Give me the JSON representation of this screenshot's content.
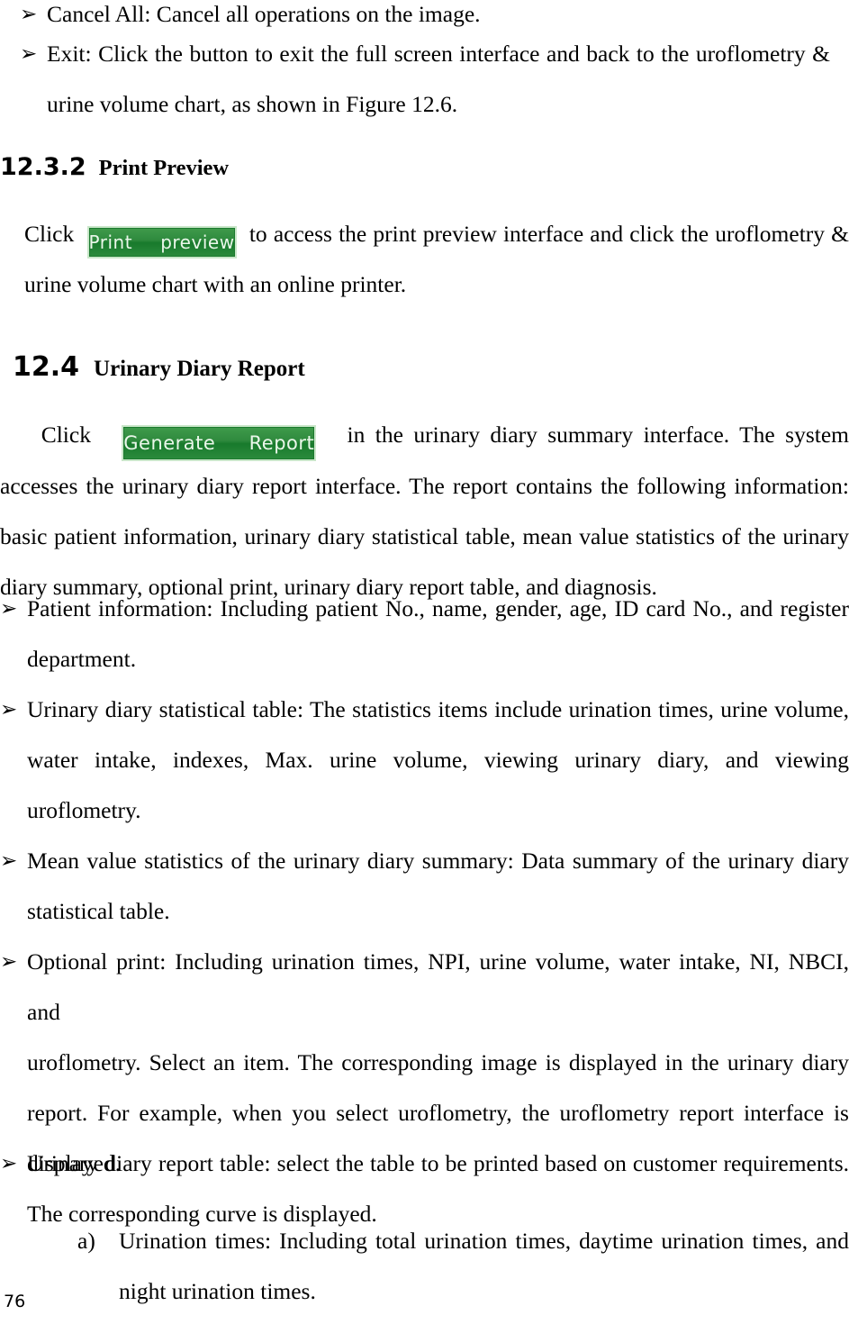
{
  "page": {
    "number": "76",
    "bullet_marker": "➢",
    "sub_marker": "a)"
  },
  "bullets": {
    "cancel_all": {
      "line1": "Cancel All: Cancel all operations on the image."
    },
    "exit": {
      "line1": "Exit: Click the button to exit the full screen interface and back to the uroflometry &",
      "line2": "urine volume chart, as shown in Figure 12.6."
    },
    "patient_information": {
      "line1": "Patient information: Including patient No., name, gender, age, ID card No., and register",
      "line2": "department."
    },
    "statistical_table": {
      "line1": "Urinary diary statistical table: The statistics items include urination times, urine volume,",
      "line2": "water intake, indexes, Max. urine volume, viewing urinary diary, and viewing",
      "line3": "uroflometry."
    },
    "mean_value": {
      "line1": "Mean value statistics of the urinary diary summary: Data summary of the urinary diary",
      "line2": "statistical table."
    },
    "optional_print": {
      "line1": "Optional print: Including urination times, NPI, urine volume, water intake, NI, NBCI, and",
      "line2": "uroflometry. Select an item. The corresponding image is displayed in the urinary diary",
      "line3": "report. For example, when you select uroflometry, the uroflometry report interface is",
      "line4": "displayed."
    },
    "report_table": {
      "line1": "Urinary diary report table: select the table to be printed based on customer requirements.",
      "line2": "The corresponding curve is displayed."
    },
    "urination_times": {
      "line1": "Urination times: Including total urination times, daytime urination times, and",
      "line2": "night urination times."
    }
  },
  "headings": {
    "print_preview": {
      "number": "12.3.2",
      "text": "Print Preview"
    },
    "urinary_diary_report": {
      "number": "12.4",
      "text": "Urinary Diary Report"
    }
  },
  "paragraphs": {
    "print_preview": {
      "click_label": "Click",
      "after_button_line1": "to access the print preview interface and click the uroflometry &",
      "line2": "urine volume chart with an online printer."
    },
    "generate_report": {
      "click_label": "Click",
      "after_button_line1": "in the urinary diary summary interface. The system",
      "line2": "accesses the urinary diary report interface. The report contains the following information:",
      "line3": "basic patient information, urinary diary statistical table, mean value statistics of the urinary",
      "line4": "diary summary, optional print, urinary diary report table, and diagnosis."
    }
  },
  "buttons": {
    "print_preview": {
      "label": "Print preview"
    },
    "generate_report": {
      "label": "Generate Report"
    }
  },
  "colors": {
    "button_green_top": "#3f9b4b",
    "button_green_bottom": "#2c8b3d",
    "button_border": "#c9e6c9",
    "text": "#000000"
  }
}
